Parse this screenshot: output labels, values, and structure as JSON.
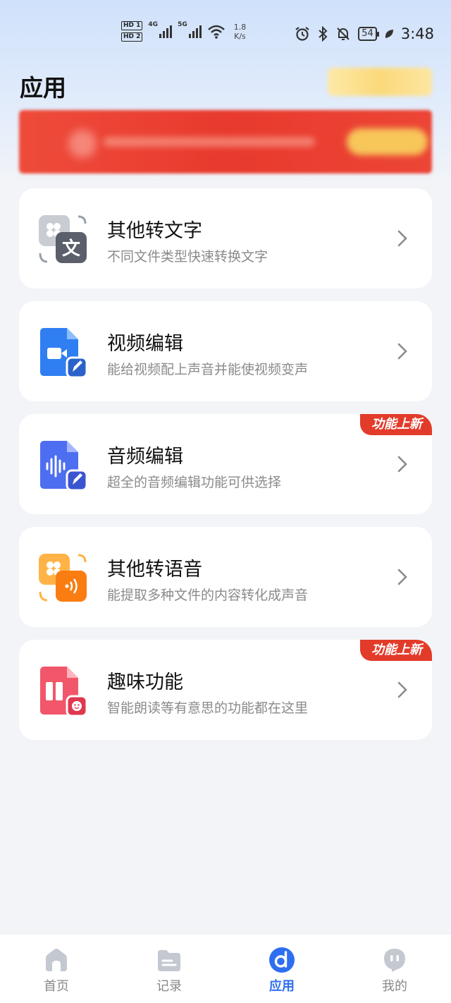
{
  "status_bar": {
    "hd1": "HD 1",
    "hd2": "HD 2",
    "net1": "4G",
    "net2": "5G",
    "speed_value": "1.8",
    "speed_unit": "K/s",
    "battery": "54",
    "time": "3:48"
  },
  "header": {
    "title": "应用"
  },
  "cards": [
    {
      "title": "其他转文字",
      "subtitle": "不同文件类型快速转换文字",
      "badge": "",
      "icon": "text-convert-icon"
    },
    {
      "title": "视频编辑",
      "subtitle": "能给视频配上声音并能使视频变声",
      "badge": "",
      "icon": "video-edit-icon"
    },
    {
      "title": "音频编辑",
      "subtitle": "超全的音频编辑功能可供选择",
      "badge": "功能上新",
      "icon": "audio-edit-icon"
    },
    {
      "title": "其他转语音",
      "subtitle": "能提取多种文件的内容转化成声音",
      "badge": "",
      "icon": "speech-convert-icon"
    },
    {
      "title": "趣味功能",
      "subtitle": "智能朗读等有意思的功能都在这里",
      "badge": "功能上新",
      "icon": "fun-feature-icon"
    }
  ],
  "tabs": [
    {
      "label": "首页",
      "icon": "home-icon",
      "active": false
    },
    {
      "label": "记录",
      "icon": "folder-icon",
      "active": false
    },
    {
      "label": "应用",
      "icon": "apps-icon",
      "active": true
    },
    {
      "label": "我的",
      "icon": "profile-icon",
      "active": false
    }
  ],
  "colors": {
    "accent": "#2e6ef0",
    "badge": "#e33b2a",
    "banner": "#e83a2e"
  }
}
